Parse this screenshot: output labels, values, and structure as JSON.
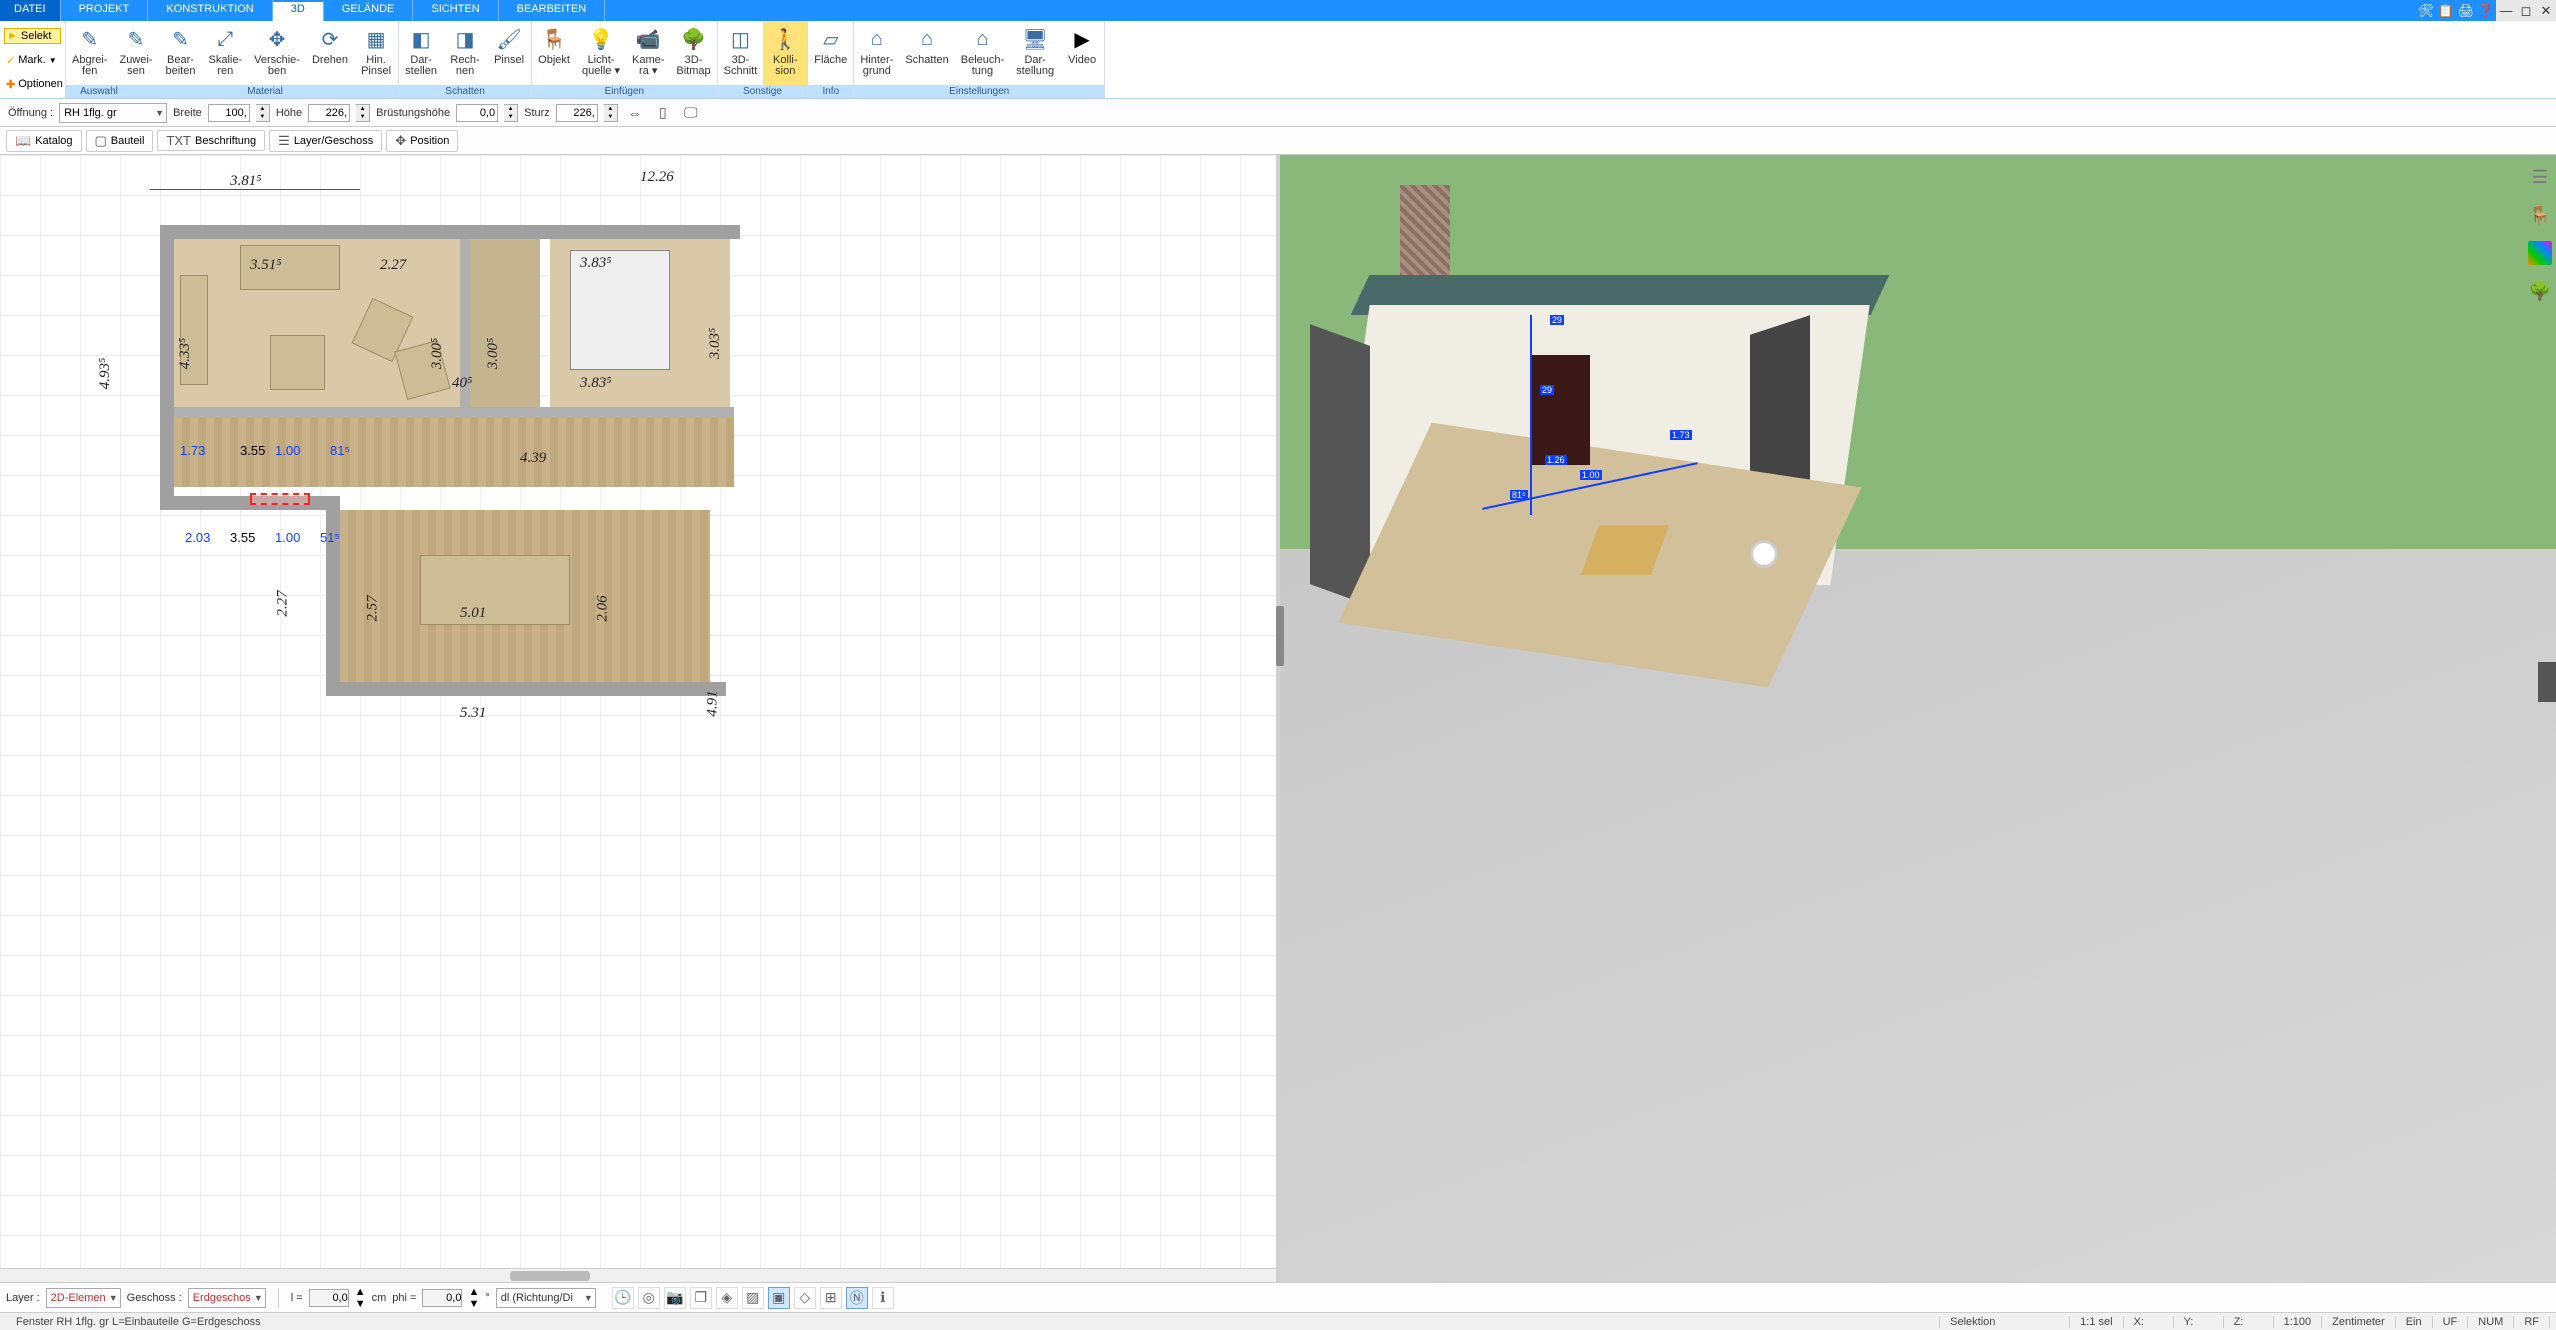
{
  "menu": {
    "tabs": [
      "DATEI",
      "PROJEKT",
      "KONSTRUKTION",
      "3D",
      "GELÄNDE",
      "SICHTEN",
      "BEARBEITEN"
    ],
    "active": "3D"
  },
  "ribbon_left": {
    "selekt": "Selekt",
    "mark": "Mark.",
    "optionen": "Optionen"
  },
  "ribbon": {
    "groups": [
      {
        "label": "Auswahl",
        "labelOnly": true
      },
      {
        "label": "Material",
        "blue": true,
        "items": [
          {
            "k": "abgreifen",
            "l1": "Abgrei-",
            "l2": "fen",
            "icon": "✎"
          },
          {
            "k": "zuweisen",
            "l1": "Zuwei-",
            "l2": "sen",
            "icon": "✎"
          },
          {
            "k": "bearbeiten",
            "l1": "Bear-",
            "l2": "beiten",
            "icon": "✎"
          },
          {
            "k": "skalieren",
            "l1": "Skalie-",
            "l2": "ren",
            "icon": "⤢"
          },
          {
            "k": "verschieben",
            "l1": "Verschie-",
            "l2": "ben",
            "icon": "✥"
          },
          {
            "k": "drehen",
            "l1": "Drehen",
            "l2": "",
            "icon": "⟳"
          },
          {
            "k": "hinpinsel",
            "l1": "Hin.",
            "l2": "Pinsel",
            "icon": "▦"
          }
        ]
      },
      {
        "label": "Schatten",
        "blue": true,
        "items": [
          {
            "k": "darstellen",
            "l1": "Dar-",
            "l2": "stellen",
            "icon": "◧"
          },
          {
            "k": "rechnen",
            "l1": "Rech-",
            "l2": "nen",
            "icon": "◨"
          },
          {
            "k": "pinsel",
            "l1": "Pinsel",
            "l2": "",
            "icon": "🖌"
          }
        ]
      },
      {
        "label": "Einfügen",
        "blue": true,
        "items": [
          {
            "k": "objekt",
            "l1": "Objekt",
            "l2": "",
            "icon": "🪑"
          },
          {
            "k": "lichtquelle",
            "l1": "Licht-",
            "l2": "quelle ▾",
            "icon": "💡"
          },
          {
            "k": "kamera",
            "l1": "Kame-",
            "l2": "ra ▾",
            "icon": "📹"
          },
          {
            "k": "3dbitmap",
            "l1": "3D-",
            "l2": "Bitmap",
            "icon": "🌳"
          }
        ]
      },
      {
        "label": "Sonstige",
        "blue": true,
        "items": [
          {
            "k": "3dschnitt",
            "l1": "3D-",
            "l2": "Schnitt",
            "icon": "◫"
          },
          {
            "k": "kollision",
            "l1": "Kolli-",
            "l2": "sion",
            "icon": "🚶",
            "active": true
          }
        ]
      },
      {
        "label": "Info",
        "blue": true,
        "items": [
          {
            "k": "flaeche",
            "l1": "Fläche",
            "l2": "",
            "icon": "▱"
          }
        ]
      },
      {
        "label": "Einstellungen",
        "blue": true,
        "items": [
          {
            "k": "hintergrund",
            "l1": "Hinter-",
            "l2": "grund",
            "icon": "⌂"
          },
          {
            "k": "schatten2",
            "l1": "Schatten",
            "l2": "",
            "icon": "⌂"
          },
          {
            "k": "beleuchtung",
            "l1": "Beleuch-",
            "l2": "tung",
            "icon": "⌂"
          },
          {
            "k": "darstellung",
            "l1": "Dar-",
            "l2": "stellung",
            "icon": "🖥"
          },
          {
            "k": "video",
            "l1": "Video",
            "l2": "",
            "icon": "▶"
          }
        ]
      }
    ]
  },
  "propbar": {
    "oeffnung_label": "Öffnung :",
    "oeffnung_value": "RH 1flg. gr",
    "breite_label": "Breite",
    "breite_value": "100,",
    "hoehe_label": "Höhe",
    "hoehe_value": "226,",
    "bruest_label": "Brüstungshöhe",
    "bruest_value": "0,0",
    "sturz_label": "Sturz",
    "sturz_value": "226,"
  },
  "toolbar2": {
    "katalog": "Katalog",
    "bauteil": "Bauteil",
    "beschriftung": "Beschriftung",
    "layer": "Layer/Geschoss",
    "position": "Position"
  },
  "plan": {
    "dims": {
      "d381": "3.81⁵",
      "d1226": "12.26",
      "d493": "4.93⁵",
      "d433": "4.33⁵",
      "d351": "3.51⁵",
      "d227a": "2.27",
      "d300a": "3.00⁵",
      "d300b": "3.00⁵",
      "d303": "3.03⁵",
      "d383a": "3.83⁵",
      "d383b": "3.83⁵",
      "d40": "40⁵",
      "d173": "1.73",
      "d355": "3.55",
      "d100": "1.00",
      "d81": "81⁵",
      "d439": "4.39",
      "d203": "2.03",
      "d355b": "3.55",
      "d100b": "1.00",
      "d51": "51⁵",
      "d227b": "2.27",
      "d257": "2.57",
      "d206": "2.06",
      "d501": "5.01",
      "d531": "5.31",
      "d491": "4.91"
    }
  },
  "gizmo": {
    "v29": "29",
    "v126": "1.26",
    "v100": "1.00",
    "v81": "81⁵",
    "v173": "1.73"
  },
  "status1": {
    "layer_label": "Layer :",
    "layer_value": "2D-Elemen",
    "geschoss_label": "Geschoss :",
    "geschoss_value": "Erdgeschos",
    "l_label": "l =",
    "l_value": "0,0",
    "cm": "cm",
    "phi_label": "phi =",
    "phi_value": "0,0",
    "deg": "°",
    "dl_value": "dl (Richtung/Di"
  },
  "status2": {
    "left": "Fenster RH 1flg. gr L=Einbauteile G=Erdgeschoss",
    "selektion": "Selektion",
    "sel_count": "1:1 sel",
    "x": "X:",
    "y": "Y:",
    "z": "Z:",
    "scale": "1:100",
    "unit": "Zentimeter",
    "ein": "Ein",
    "uf": "UF",
    "num": "NUM",
    "rf": "RF"
  }
}
